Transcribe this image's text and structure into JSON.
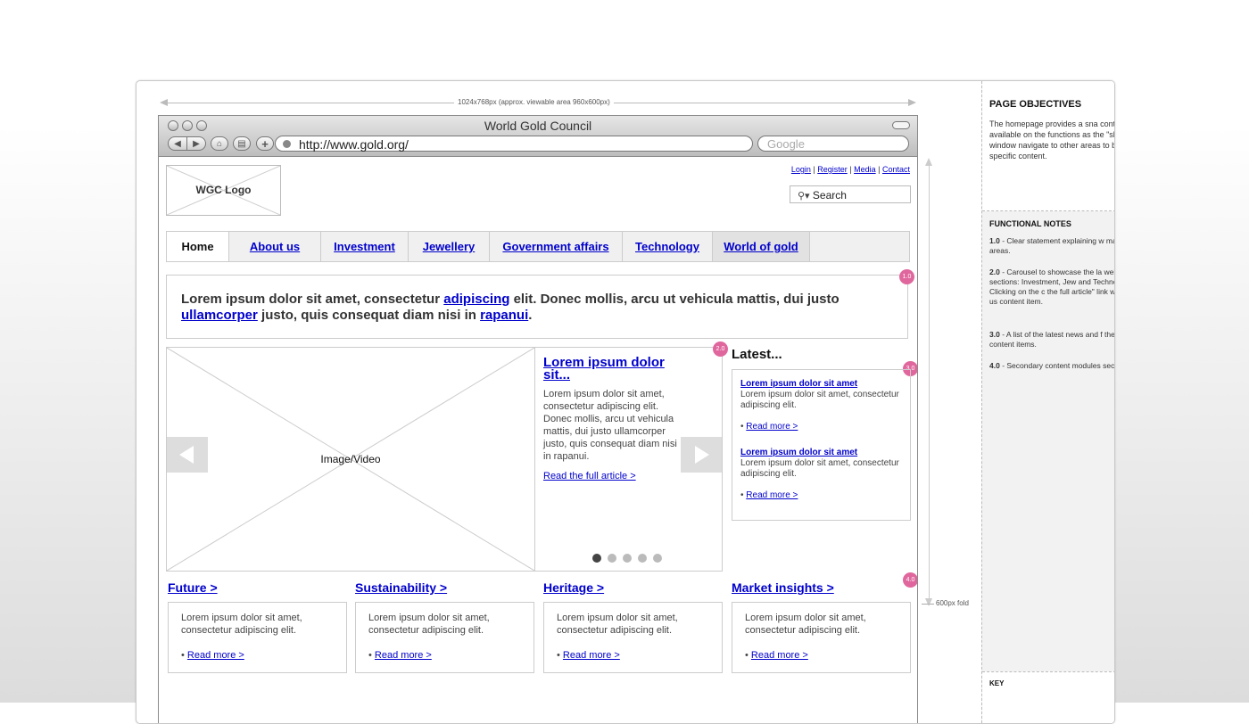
{
  "annotations": {
    "viewport_label": "1024x768px (approx. viewable area 960x600px)",
    "fold_label": "600px fold"
  },
  "browser": {
    "window_title": "World Gold Council",
    "url": "http://www.gold.org/",
    "search_placeholder": "Google"
  },
  "site": {
    "logo_label": "WGC Logo",
    "top_links": [
      "Login",
      "Register",
      "Media",
      "Contact"
    ],
    "search_label": "Search",
    "nav": [
      "Home",
      "About us",
      "Investment",
      "Jewellery",
      "Government affairs",
      "Technology",
      "World of gold"
    ],
    "intro": {
      "t1": "Lorem ipsum dolor sit amet, consectetur ",
      "l1": "adipiscing",
      "t2": " elit. Donec mollis, arcu ut vehicula mattis, dui justo ",
      "l2": "ullamcorper",
      "t3": " justo, quis consequat diam nisi in ",
      "l3": "rapanui",
      "t4": "."
    },
    "carousel": {
      "media_label": "Image/Video",
      "title": "Lorem ipsum dolor sit...",
      "body": "Lorem ipsum dolor sit amet, consectetur adipiscing elit. Donec mollis, arcu ut vehicula mattis, dui justo ullamcorper justo, quis consequat diam nisi in rapanui.",
      "link": "Read the full article >",
      "slide_count": 5,
      "active_slide": 1
    },
    "latest": {
      "heading": "Latest...",
      "items": [
        {
          "title": "Lorem ipsum dolor sit amet",
          "body": "Lorem ipsum dolor sit amet, consectetur adipiscing elit.",
          "link": "Read more >"
        },
        {
          "title": "Lorem ipsum dolor sit amet",
          "body": "Lorem ipsum dolor sit amet, consectetur adipiscing elit.",
          "link": "Read more >"
        }
      ]
    },
    "modules": [
      {
        "title": "Future  >",
        "body": "Lorem ipsum dolor sit amet, consectetur adipiscing elit.",
        "link": "Read more >"
      },
      {
        "title": "Sustainability  >",
        "body": "Lorem ipsum dolor sit amet, consectetur adipiscing elit.",
        "link": "Read more >"
      },
      {
        "title": "Heritage >",
        "body": "Lorem ipsum dolor sit amet, consectetur adipiscing elit.",
        "link": "Read more >"
      },
      {
        "title": "Market insights >",
        "body": "Lorem ipsum dolor sit amet, consectetur adipiscing elit.",
        "link": "Read more >"
      }
    ],
    "badges": [
      "1.0",
      "2.0",
      "3.0",
      "4.0"
    ]
  },
  "panel": {
    "objectives_heading": "PAGE OBJECTIVES",
    "objectives_text": "The homepage provides a sna content areas available on the functions as the \"shop window navigate to other areas to bec specific content.",
    "notes_heading": "FUNCTIONAL NOTES",
    "notes": [
      {
        "num": "1.0",
        "text": " - Clear statement explaining w main content areas."
      },
      {
        "num": "2.0",
        "text": " - Carousel to showcase the la website sections: Investment, Jew and Technology. Clicking on the c the full article\" link will take the us content item."
      },
      {
        "num": "3.0",
        "text": " - A list of the latest news and f the full content items."
      },
      {
        "num": "4.0",
        "text": " - Secondary content modules sections."
      }
    ],
    "key_heading": "KEY"
  },
  "colors": {
    "link": "#0000cc",
    "badge": "#e0679d"
  }
}
